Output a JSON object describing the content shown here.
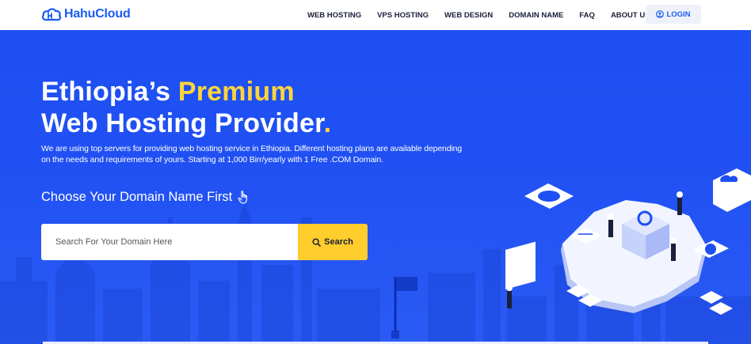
{
  "header": {
    "logo_text": "HahuCloud",
    "nav": [
      {
        "label": "WEB HOSTING"
      },
      {
        "label": "VPS HOSTING"
      },
      {
        "label": "WEB DESIGN"
      },
      {
        "label": "DOMAIN NAME"
      },
      {
        "label": "FAQ"
      },
      {
        "label": "ABOUT US"
      }
    ],
    "login_label": "LOGIN"
  },
  "hero": {
    "title_part1": "Ethiopia’s ",
    "title_highlight": "Premium",
    "title_line2": "Web Hosting Provider",
    "title_dot": ".",
    "description": "We are using top servers for providing web hosting service in Ethiopia. Different hosting plans are available depending on the needs and requirements of yours. Starting at 1,000 Birr/yearly with 1 Free .COM Domain.",
    "choose_text": "Choose Your Domain Name First",
    "search_placeholder": "Search For Your Domain Here",
    "search_button": "Search"
  },
  "colors": {
    "brand_blue": "#1b5cf5",
    "hero_blue": "#1d4ff2",
    "accent_yellow": "#ffd43b",
    "button_yellow": "#ffcd2c"
  },
  "icons": [
    "cloud-logo-icon",
    "user-icon",
    "pointing-hand-icon",
    "search-icon"
  ]
}
